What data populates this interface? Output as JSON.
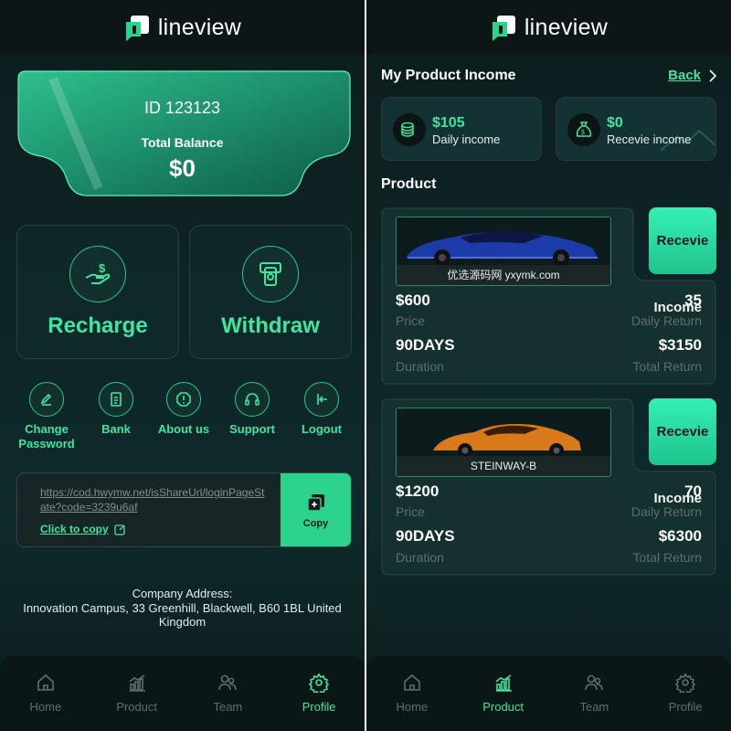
{
  "brand": {
    "name": "lineview",
    "accent": "#3ee6a0"
  },
  "profile": {
    "id_text": "ID 123123",
    "balance_label": "Total Balance",
    "balance_value": "$0",
    "actions": [
      {
        "label": "Recharge",
        "icon": "hand-money-icon"
      },
      {
        "label": "Withdraw",
        "icon": "atm-card-icon"
      }
    ],
    "menu": [
      {
        "label": "Change Password",
        "icon": "pencil-icon"
      },
      {
        "label": "Bank",
        "icon": "document-icon"
      },
      {
        "label": "About us",
        "icon": "alert-shield-icon"
      },
      {
        "label": "Support",
        "icon": "headset-icon"
      },
      {
        "label": "Logout",
        "icon": "logout-icon"
      }
    ],
    "share": {
      "link": "https://cod.hwymw.net/isShareUrl/loginPageState?code=3239u6af",
      "click_label": "Click to copy",
      "copy_label": "Copy"
    },
    "address": {
      "title": "Company Address:",
      "line1": "Innovation Campus, 33 Greenhill, Blackwell, B60 1BL United",
      "line2": "Kingdom"
    }
  },
  "income_page": {
    "title": "My Product Income",
    "back_label": "Back",
    "daily": {
      "value": "$105",
      "label": "Daily income"
    },
    "receive": {
      "value": "$0",
      "label": "Recevie income"
    },
    "products_title": "Product",
    "products": [
      {
        "caption": "优选源码网 yxymk.com",
        "car_color": "blue",
        "button": "Recevie",
        "price": "$600",
        "price_label": "Price",
        "daily_return": "35",
        "income_overlay": "Income",
        "daily_return_label": "Daily Return",
        "duration": "90DAYS",
        "duration_label": "Duration",
        "total_return": "$3150",
        "total_return_label": "Total Return"
      },
      {
        "caption": "STEINWAY-B",
        "car_color": "orange",
        "button": "Recevie",
        "price": "$1200",
        "price_label": "Price",
        "daily_return": "70",
        "income_overlay": "Income",
        "daily_return_label": "Daily Return",
        "duration": "90DAYS",
        "duration_label": "Duration",
        "total_return": "$6300",
        "total_return_label": "Total Return"
      }
    ]
  },
  "nav_left": {
    "items": [
      "Home",
      "Product",
      "Team",
      "Profile"
    ],
    "active": "Profile"
  },
  "nav_right": {
    "items": [
      "Home",
      "Product",
      "Team",
      "Profile"
    ],
    "active": "Product"
  }
}
